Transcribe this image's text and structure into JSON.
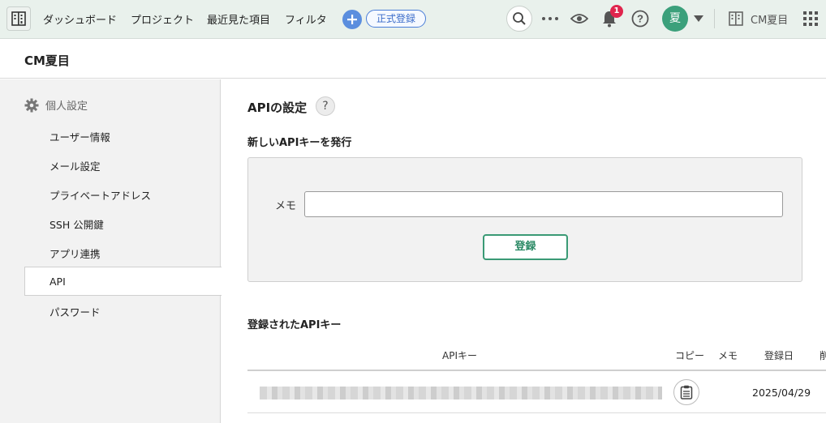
{
  "topbar": {
    "nav": [
      "ダッシュボード",
      "プロジェクト",
      "最近見た項目",
      "フィルタ"
    ],
    "register_label": "正式登録",
    "notification_count": "1",
    "avatar_initial": "夏",
    "space_name": "CM夏目"
  },
  "header": {
    "title": "CM夏目"
  },
  "sidebar": {
    "heading": "個人設定",
    "items": [
      "ユーザー情報",
      "メール設定",
      "プライベートアドレス",
      "SSH 公開鍵",
      "アプリ連携",
      "API",
      "パスワード"
    ],
    "active_index": 5
  },
  "main": {
    "title": "APIの設定",
    "help": "?",
    "new_key": {
      "heading": "新しいAPIキーを発行",
      "memo_label": "メモ",
      "memo_value": "",
      "submit_label": "登録"
    },
    "registered": {
      "heading": "登録されたAPIキー",
      "columns": [
        "APIキー",
        "コピー",
        "メモ",
        "登録日",
        "削"
      ],
      "rows": [
        {
          "key": "",
          "memo": "",
          "date": "2025/04/29"
        }
      ]
    }
  },
  "colors": {
    "accent_green": "#3a9a75",
    "nav_blue": "#5b8ede",
    "badge_red": "#e0254d",
    "avatar_green": "#3ba07b"
  }
}
